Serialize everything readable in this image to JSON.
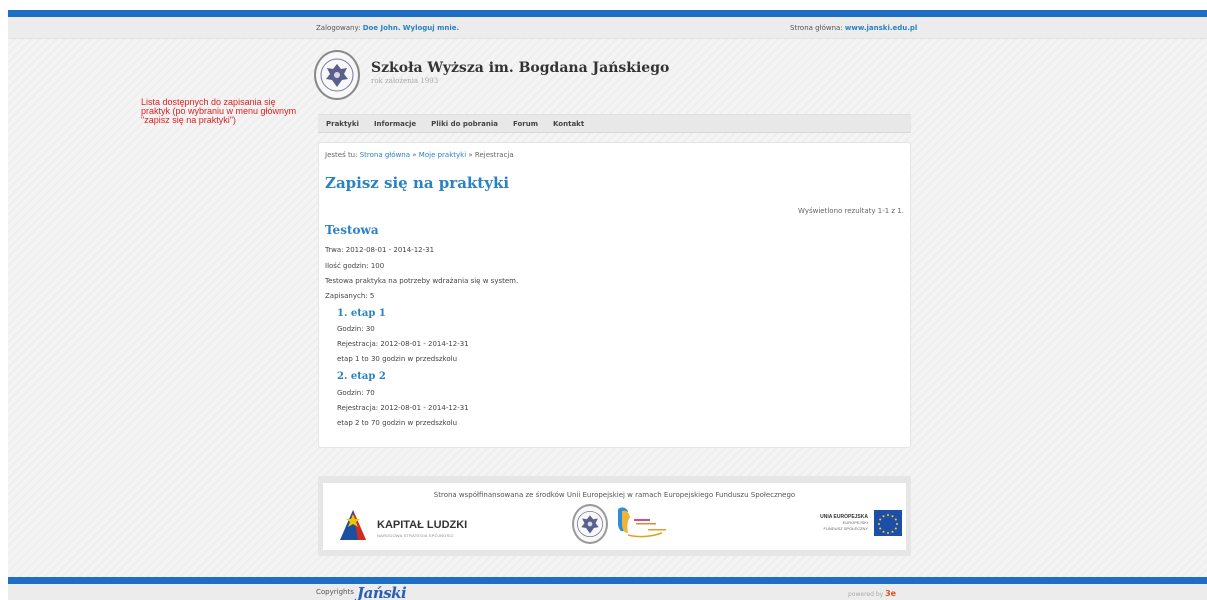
{
  "colors": {
    "brand_blue": "#1e6fc4",
    "link_blue": "#2a82c4",
    "annotation_red": "#e02020"
  },
  "topbar": {
    "login_prefix": "Zalogowany:",
    "user_name": "Doe John.",
    "logout": "Wyloguj mnie.",
    "homepage_prefix": "Strona główna:",
    "homepage_link": "www.janski.edu.pl"
  },
  "header": {
    "title": "Szkoła Wyższa im. Bogdana Jańskiego",
    "subtitle": "rok założenia 1993"
  },
  "annotation": "Lista dostępnych do zapisania się praktyk (po wybraniu w menu głównym \"zapisz się na praktyki\")",
  "nav": {
    "items": [
      "Praktyki",
      "Informacje",
      "Pliki do pobrania",
      "Forum",
      "Kontakt"
    ]
  },
  "breadcrumb": {
    "prefix": "Jesteś tu:",
    "home": "Strona główna",
    "sep1": "»",
    "my_internships": "Moje praktyki",
    "sep2": "»",
    "current": "Rejestracja"
  },
  "page_title": "Zapisz się na praktyki",
  "results_count": "Wyświetlono rezultaty 1-1 z 1.",
  "internship": {
    "name": "Testowa",
    "duration_label": "Trwa:",
    "duration": "2012-08-01 - 2014-12-31",
    "hours_label": "Ilość godzin:",
    "hours": "100",
    "description": "Testowa praktyka na potrzeby wdrażania się w system.",
    "enrolled_label": "Zapisanych:",
    "enrolled": "5",
    "stages": [
      {
        "title": "1. etap 1",
        "hours_label": "Godzin:",
        "hours": "30",
        "registration_label": "Rejestracja:",
        "registration": "2012-08-01 - 2014-12-31",
        "description": "etap 1 to 30 godzin w przedszkolu"
      },
      {
        "title": "2. etap 2",
        "hours_label": "Godzin:",
        "hours": "70",
        "registration_label": "Rejestracja:",
        "registration": "2012-08-01 - 2014-12-31",
        "description": "etap 2 to 70 godzin w przedszkolu"
      }
    ]
  },
  "footer": {
    "eu_text": "Strona współfinansowana ze środków Unii Europejskiej w ramach Europejskiego Funduszu Społecznego",
    "kl_title": "KAPITAŁ LUDZKI",
    "kl_subtitle": "NARODOWA STRATEGIA SPÓJNOŚCI",
    "eu_label_1": "UNIA EUROPEJSKA",
    "eu_label_2": "EUROPEJSKI",
    "eu_label_3": "FUNDUSZ SPOŁECZNY"
  },
  "bottom": {
    "copyright": "Copyrights",
    "logo_text": "Jański",
    "powered_by": "powered by",
    "powered_mark": "3e"
  }
}
